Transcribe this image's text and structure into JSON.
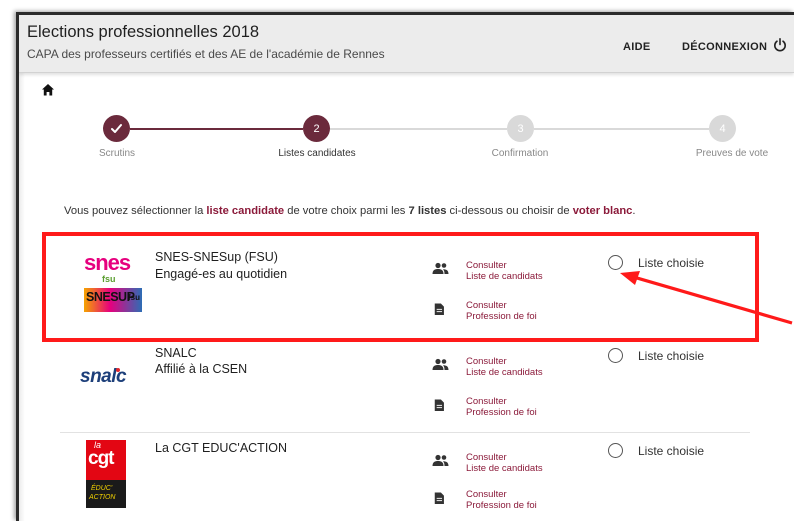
{
  "header": {
    "title": "Elections professionnelles 2018",
    "subtitle": "CAPA des professeurs certifiés et des AE de l'académie de Rennes",
    "help_label": "AIDE",
    "logout_label": "DÉCONNEXION"
  },
  "stepper": {
    "steps": [
      {
        "number": "",
        "label": "Scrutins",
        "state": "done"
      },
      {
        "number": "2",
        "label": "Listes candidates",
        "state": "active"
      },
      {
        "number": "3",
        "label": "Confirmation",
        "state": "pending"
      },
      {
        "number": "4",
        "label": "Preuves de vote",
        "state": "pending"
      }
    ]
  },
  "intro": {
    "part1": "Vous pouvez sélectionner la ",
    "bold1": "liste candidate",
    "part2": " de votre choix parmi les ",
    "bold2": "7 listes",
    "part3": " ci-dessous ou choisir de ",
    "bold3": "voter blanc",
    "part4": "."
  },
  "lists": [
    {
      "name": "SNES-SNESup (FSU)",
      "slogan": "Engagé-es au quotidien",
      "logo_text_1": "snes",
      "logo_text_2": "fsu",
      "logo_text_3": "SNESUP",
      "logo_text_4": "fsu",
      "candidates_line1": "Consulter",
      "candidates_line2": "Liste de candidats",
      "profession_line1": "Consulter",
      "profession_line2": "Profession de foi",
      "choice_label": "Liste choisie"
    },
    {
      "name": "SNALC",
      "slogan": "Affilié à la CSEN",
      "logo_text_1": "snalc",
      "candidates_line1": "Consulter",
      "candidates_line2": "Liste de candidats",
      "profession_line1": "Consulter",
      "profession_line2": "Profession de foi",
      "choice_label": "Liste choisie"
    },
    {
      "name": "La CGT EDUC'ACTION",
      "slogan": "",
      "logo_text_1": "cgt",
      "logo_text_2": "la",
      "logo_text_3": "ÉDUC'",
      "logo_text_4": "ACTION",
      "candidates_line1": "Consulter",
      "candidates_line2": "Liste de candidats",
      "profession_line1": "Consulter",
      "profession_line2": "Profession de foi",
      "choice_label": "Liste choisie"
    }
  ],
  "colors": {
    "accent": "#8b1a3a",
    "stepper_done": "#6b2a3c",
    "stepper_pending": "#d9d9d9",
    "annotation_red": "#ff1a1a"
  },
  "icons": {
    "home": "home-icon",
    "power": "power-icon",
    "candidates": "people-icon",
    "profession": "document-icon",
    "done_step": "check-icon"
  }
}
